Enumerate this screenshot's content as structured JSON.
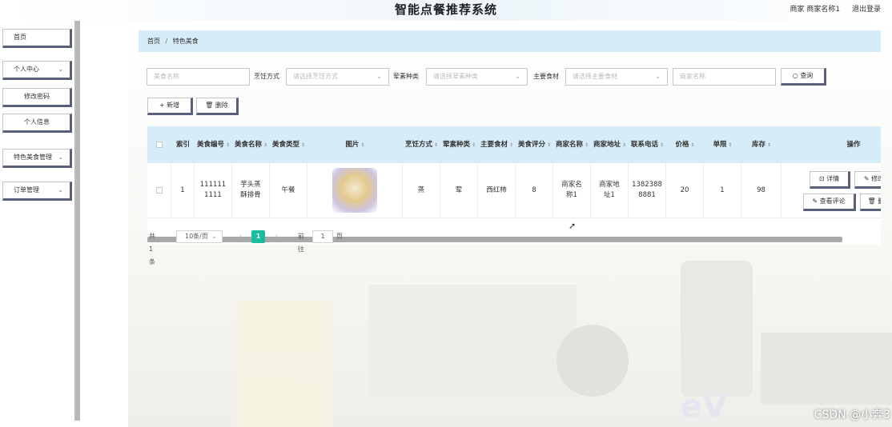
{
  "header": {
    "title": "智能点餐推荐系统",
    "user_info": "商家 商家名称1",
    "logout": "退出登录"
  },
  "sidebar": {
    "items": [
      {
        "label": "首页"
      },
      {
        "label": "个人中心",
        "expandable": true
      },
      {
        "label": "修改密码"
      },
      {
        "label": "个人信息"
      },
      {
        "label": "特色美食管理",
        "expandable": true
      },
      {
        "label": "订单管理",
        "expandable": true
      }
    ]
  },
  "breadcrumb": {
    "home": "首页",
    "separator": "/",
    "current": "特色美食"
  },
  "search": {
    "name_placeholder": "美食名称",
    "cooking_label": "烹饪方式",
    "cooking_placeholder": "请选择烹饪方式",
    "meat_label": "荤素种类",
    "meat_placeholder": "请选择荤素种类",
    "ingredient_label": "主要食材",
    "ingredient_placeholder": "请选择主要食材",
    "merchant_placeholder": "商家名称",
    "query_label": "查询"
  },
  "toolbar": {
    "add_label": "新增",
    "delete_label": "删除"
  },
  "table": {
    "headers": {
      "index": "索引",
      "code": "美食编号",
      "name": "美食名称",
      "type": "美食类型",
      "image": "图片",
      "cooking": "烹饪方式",
      "meat": "荤素种类",
      "ingredient": "主要食材",
      "rating": "美食评分",
      "merchant_name": "商家名称",
      "merchant_address": "商家地址",
      "phone": "联系电话",
      "price": "价格",
      "limit": "单限",
      "stock": "库存",
      "ops": "操作"
    },
    "rows": [
      {
        "index": "1",
        "code": "1111111111",
        "name": "芋头蒸酥排骨",
        "type": "午餐",
        "cooking": "蒸",
        "meat": "荤",
        "ingredient": "西红柿",
        "rating": "8",
        "merchant_name": "商家名称1",
        "merchant_address": "商家地址1",
        "phone": "13823888881",
        "price": "20",
        "limit": "1",
        "stock": "98"
      }
    ],
    "row_actions": {
      "detail": "详情",
      "edit": "修改",
      "review": "查看评论",
      "delete": "删除"
    }
  },
  "pagination": {
    "total": "共 1 条",
    "page_size": "10条/页",
    "current_page": "1",
    "goto_label": "前往",
    "goto_value": "1",
    "page_unit": "页"
  },
  "watermark": "CSDN @小奔3",
  "logo_text": "eV"
}
